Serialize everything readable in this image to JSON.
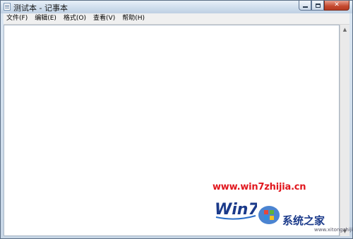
{
  "window": {
    "title": "测试本 - 记事本"
  },
  "caption_buttons": {
    "minimize": "minimize",
    "maximize": "maximize",
    "close": "close"
  },
  "menu": {
    "items": [
      {
        "label": "文件(F)"
      },
      {
        "label": "编辑(E)"
      },
      {
        "label": "格式(O)"
      },
      {
        "label": "查看(V)"
      },
      {
        "label": "帮助(H)"
      }
    ]
  },
  "editor": {
    "content": ""
  },
  "watermark": {
    "url": "www.win7zhijia.cn",
    "logo_text": "Win7",
    "site_name": "系统之家",
    "small_text": "www.xitongzhijia.net"
  },
  "colors": {
    "watermark_red": "#e1171e",
    "watermark_blue": "#1b3a8a"
  }
}
